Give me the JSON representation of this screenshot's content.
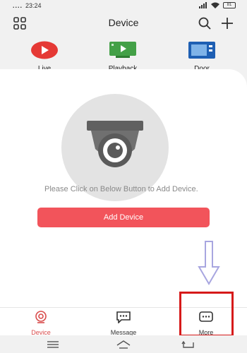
{
  "status_bar": {
    "signal_dots": "....",
    "time": "23:24",
    "battery": "81"
  },
  "header": {
    "title": "Device",
    "icons": [
      "grid-icon",
      "search-icon",
      "plus-icon"
    ]
  },
  "quick_access": [
    {
      "label": "Live",
      "icon": "live-play-icon",
      "color": "#e53935"
    },
    {
      "label": "Playback",
      "icon": "playback-icon",
      "color": "#43a047"
    },
    {
      "label": "Door",
      "icon": "door-intercom-icon",
      "color": "#1e5fb3"
    }
  ],
  "empty_state": {
    "icon": "dome-camera-icon",
    "hint": "Please Click on Below Button to Add Device.",
    "button_label": "Add Device",
    "button_color": "#f2545b"
  },
  "bottom_nav": [
    {
      "label": "Device",
      "icon": "device-tab-icon",
      "active": true
    },
    {
      "label": "Message",
      "icon": "message-icon",
      "active": false
    },
    {
      "label": "More",
      "icon": "more-icon",
      "active": false
    }
  ],
  "colors": {
    "accent": "#d94c4c",
    "highlight_box": "#d61a1a",
    "annotation_arrow": "#a8a6e0"
  }
}
